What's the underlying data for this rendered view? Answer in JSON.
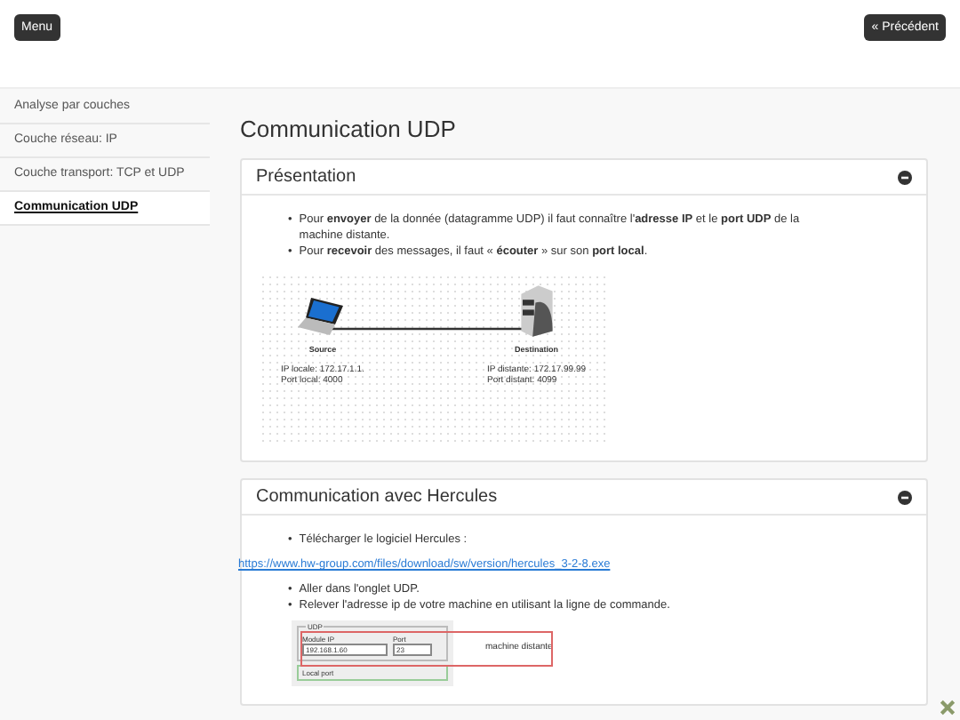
{
  "header": {
    "menu_button": "Menu",
    "previous_button": "« Précédent"
  },
  "sidebar": {
    "items": [
      {
        "label": "Analyse par couches",
        "selected": false
      },
      {
        "label": "Couche réseau: IP",
        "selected": false
      },
      {
        "label": "Couche transport: TCP et UDP",
        "selected": false
      },
      {
        "label": "Communication UDP",
        "selected": true
      }
    ]
  },
  "page_title": "Communication UDP",
  "sections": [
    {
      "title": "Présentation",
      "expanded": true,
      "bullets": [
        {
          "marker": "•",
          "text": "Pour **envoyer** de la donnée (datagramme UDP) il faut connaître l'**adresse IP** et le **port UDP** de la machine distante."
        },
        {
          "marker": "•",
          "text": "Pour **recevoir** des messages, il faut « **écouter** » sur son **port local**."
        }
      ],
      "diagram": {
        "source": {
          "label": "Source",
          "lines": [
            "IP locale: 172.17.1.1.",
            "Port local: 4000"
          ]
        },
        "destination": {
          "label": "Destination",
          "lines": [
            "IP distante: 172.17.99.99",
            "Port distant: 4099"
          ]
        }
      }
    },
    {
      "title": "Communication avec Hercules",
      "expanded": true,
      "bullets": [
        {
          "marker": "•",
          "text": "Télécharger le logiciel Hercules :"
        }
      ],
      "link": "https://www.hw-group.com/files/download/sw/version/hercules_3-2-8.exe",
      "bullets_after": [
        {
          "marker": "•",
          "text": "Aller dans l'onglet UDP."
        },
        {
          "marker": "•",
          "text": "Relever l'adresse ip de votre machine en utilisant la ligne de commande."
        }
      ],
      "hercules": {
        "group": "UDP",
        "ip_label": "Module IP",
        "ip_value": "192.168.1.60",
        "port_label": "Port",
        "port_value": "23",
        "note": "machine distante",
        "local_label": "Local port"
      }
    }
  ]
}
